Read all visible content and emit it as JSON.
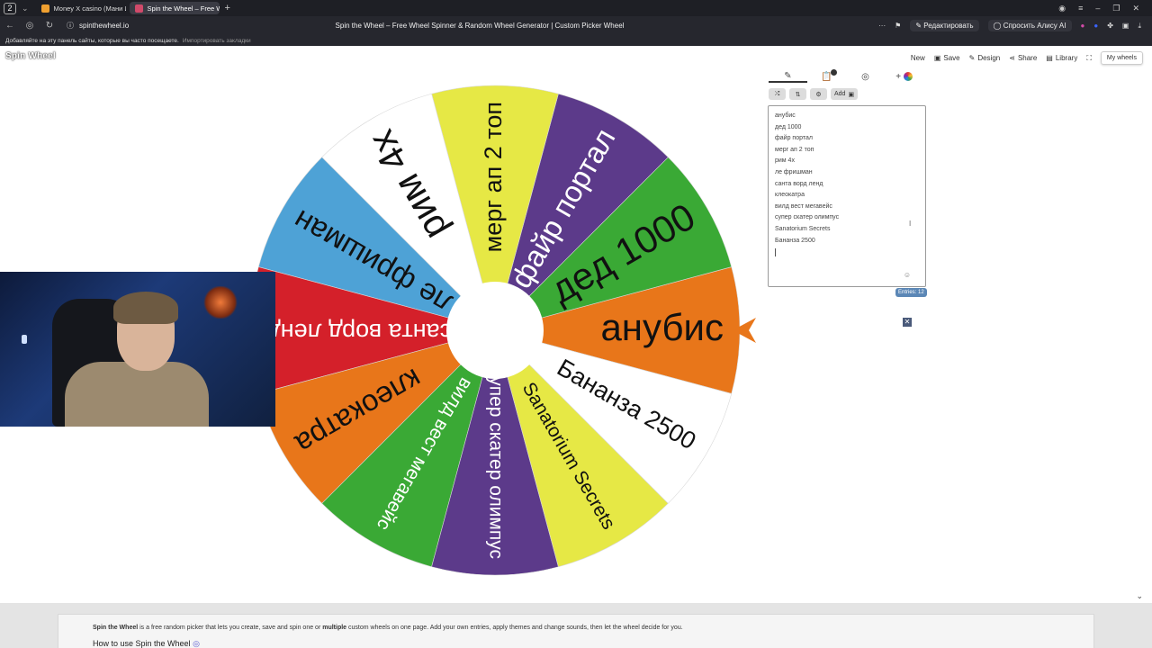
{
  "browser": {
    "tab_count": "2",
    "tabs": [
      {
        "label": "Money X casino (Мани И...",
        "color": "#f0a030"
      },
      {
        "label": "Spin the Wheel – Free W...",
        "color": "#d04a6a"
      }
    ],
    "url": "spinthewheel.io",
    "page_title": "Spin the Wheel – Free Wheel Spinner & Random Wheel Generator | Custom Picker Wheel",
    "edit_label": "Редактировать",
    "ask_label": "Спросить Алису AI",
    "bookmarks_hint": "Добавляйте на эту панель сайты, которые вы часто посещаете.",
    "bookmarks_import": "Импортировать закладки"
  },
  "site": {
    "logo": "Spin Wheel",
    "menu": {
      "new": "New",
      "save": "Save",
      "design": "Design",
      "share": "Share",
      "library": "Library",
      "my_wheels": "My wheels"
    }
  },
  "wheel": {
    "segments": [
      {
        "label": "анубис",
        "color": "#e8761a",
        "text_color": "#111111"
      },
      {
        "label": "дед 1000",
        "color": "#3aa935",
        "text_color": "#111111"
      },
      {
        "label": "файр портал",
        "color": "#5c3a8a",
        "text_color": "#ffffff"
      },
      {
        "label": "мерг ап 2 топ",
        "color": "#e6e845",
        "text_color": "#111111"
      },
      {
        "label": "рим 4х",
        "color": "#ffffff",
        "text_color": "#111111"
      },
      {
        "label": "ле фришман",
        "color": "#4ea2d6",
        "text_color": "#111111"
      },
      {
        "label": "санта ворд ленд",
        "color": "#d4202a",
        "text_color": "#ffffff"
      },
      {
        "label": "клеокатра",
        "color": "#e8761a",
        "text_color": "#111111"
      },
      {
        "label": "вилд вест мегавейс",
        "color": "#3aa935",
        "text_color": "#ffffff"
      },
      {
        "label": "супер скатер олимпус",
        "color": "#5c3a8a",
        "text_color": "#ffffff"
      },
      {
        "label": "Sanatorium Secrets",
        "color": "#e6e845",
        "text_color": "#111111"
      },
      {
        "label": "Бананза 2500",
        "color": "#ffffff",
        "text_color": "#111111"
      }
    ],
    "pointer_color": "#e8761a"
  },
  "editor": {
    "add_label": "Add",
    "entries": [
      "анубис",
      "дед 1000",
      "файр портал",
      "мерг ап 2 топ",
      "рим 4х",
      "ле фришман",
      "санта ворд ленд",
      "клеокатра",
      "вилд вест мегавейс",
      "супер скатер олимпус",
      "Sanatorium Secrets",
      "Бананза 2500"
    ],
    "entries_count": "Entries: 12"
  },
  "info": {
    "lead_bold": "Spin the Wheel",
    "lead_text": " is a free random picker that lets you create, save and spin one or ",
    "multiple_bold": "multiple",
    "rest_text": " custom wheels on one page. Add your own entries, apply themes and change sounds, then let the wheel decide for you.",
    "how_title": "How to use Spin the Wheel"
  }
}
